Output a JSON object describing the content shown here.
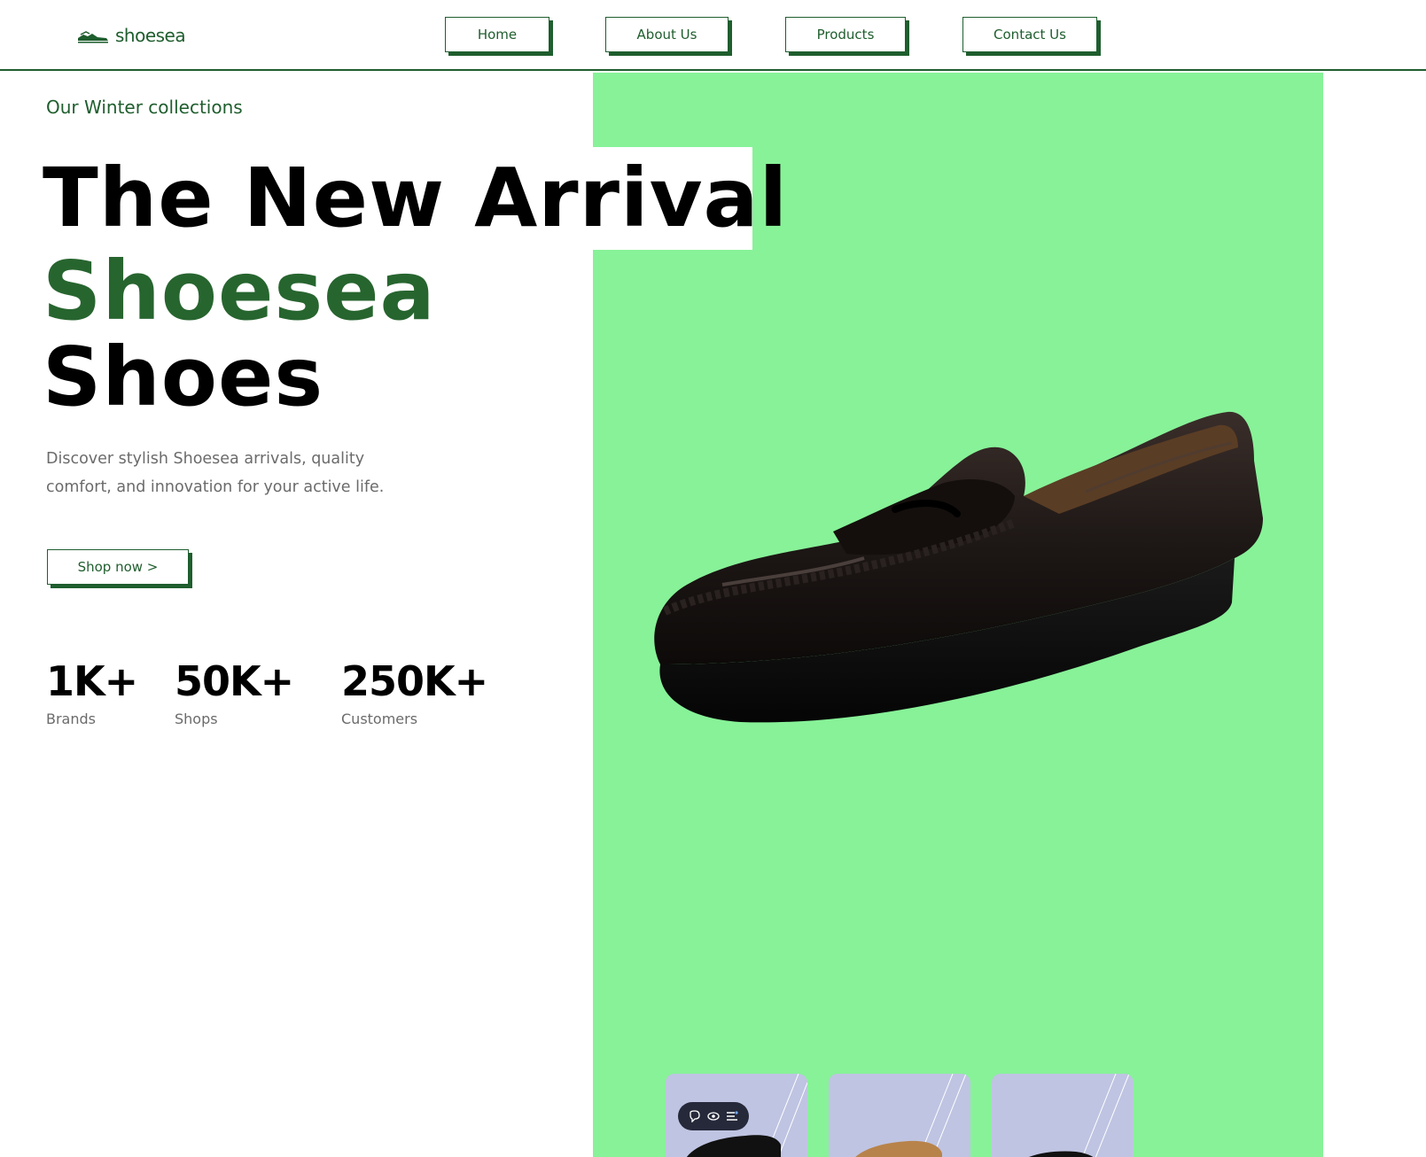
{
  "header": {
    "logo_text": "shoesea",
    "nav": [
      {
        "label": "Home"
      },
      {
        "label": "About Us"
      },
      {
        "label": "Products"
      },
      {
        "label": "Contact Us"
      }
    ]
  },
  "hero": {
    "subtitle": "Our Winter collections",
    "headline_line1": "The New Arrival",
    "headline_line2": "Shoesea",
    "headline_line3": "Shoes",
    "description": "Discover stylish Shoesea arrivals, quality comfort, and innovation for your active life.",
    "cta_label": "Shop now >"
  },
  "stats": [
    {
      "value": "1K+",
      "label": "Brands"
    },
    {
      "value": "50K+",
      "label": "Shops"
    },
    {
      "value": "250K+",
      "label": "Customers"
    }
  ],
  "thumbnails": [
    {
      "icon": "black-loafer-thumb"
    },
    {
      "icon": "tan-loafer-thumb"
    },
    {
      "icon": "black-shoe-thumb"
    }
  ],
  "colors": {
    "brand_green": "#1f5e2e",
    "headline_green": "#27652f",
    "panel_green": "#87f298",
    "thumb_bg": "#bfc4e2",
    "toolbar_bg": "#26293a"
  }
}
